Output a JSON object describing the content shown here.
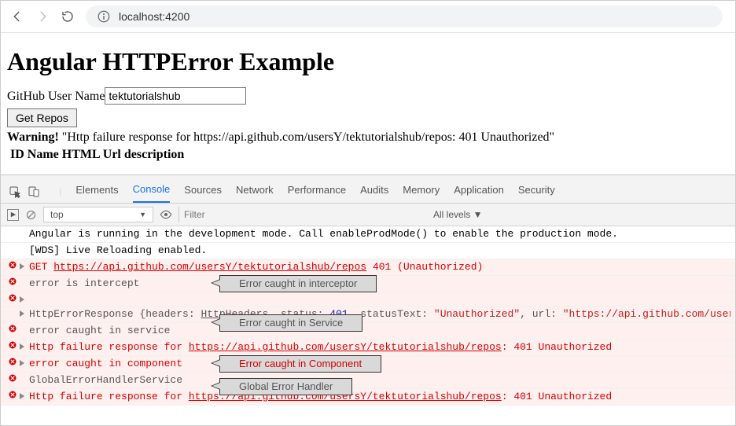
{
  "browser": {
    "url": "localhost:4200"
  },
  "page": {
    "title": "Angular HTTPError Example",
    "input_label": "GitHub User Name",
    "input_value": "tektutorialshub",
    "button_label": "Get Repos",
    "warning_prefix": "Warning!",
    "warning_text": " \"Http failure response for https://api.github.com/usersY/tektutorialshub/repos: 401 Unauthorized\"",
    "columns": "ID Name HTML Url description"
  },
  "devtools": {
    "tabs": {
      "elements": "Elements",
      "console": "Console",
      "sources": "Sources",
      "network": "Network",
      "performance": "Performance",
      "audits": "Audits",
      "memory": "Memory",
      "application": "Application",
      "security": "Security"
    },
    "context": "top",
    "filter_placeholder": "Filter",
    "levels": "All levels ▼"
  },
  "console": {
    "l1": "Angular is running in the development mode. Call enableProdMode() to enable the production mode.",
    "l2": "[WDS] Live Reloading enabled.",
    "l3_method": "GET ",
    "l3_url": "https://api.github.com/usersY/tektutorialshub/repos",
    "l3_status": " 401 (Unauthorized)",
    "l4": "error is intercept",
    "l5a": "HttpErrorResponse {headers: ",
    "l5b": "HttpHeaders",
    "l5c": ", status: ",
    "l5d": "401",
    "l5e": ", statusText: ",
    "l5f": "\"Unauthorized\"",
    "l5g": ", url: ",
    "l5h": "\"https://api.github.com/usersY/tek",
    "l6": "error caught in service",
    "l7a": "Http failure response for ",
    "l7b": "https://api.github.com/usersY/tektutorialshub/repos",
    "l7c": ": 401 Unauthorized",
    "l8": "error caught in component",
    "l9": "GlobalErrorHandlerService",
    "l10a": "Http failure response for ",
    "l10b": "https://api.github.com/usersY/tektutorialshub/repos",
    "l10c": ": 401 Unauthorized"
  },
  "callouts": {
    "c1": "Error caught in interceptor",
    "c2": "Error caught in Service",
    "c3": "Error caught in Component",
    "c4": "Global Error Handler"
  }
}
